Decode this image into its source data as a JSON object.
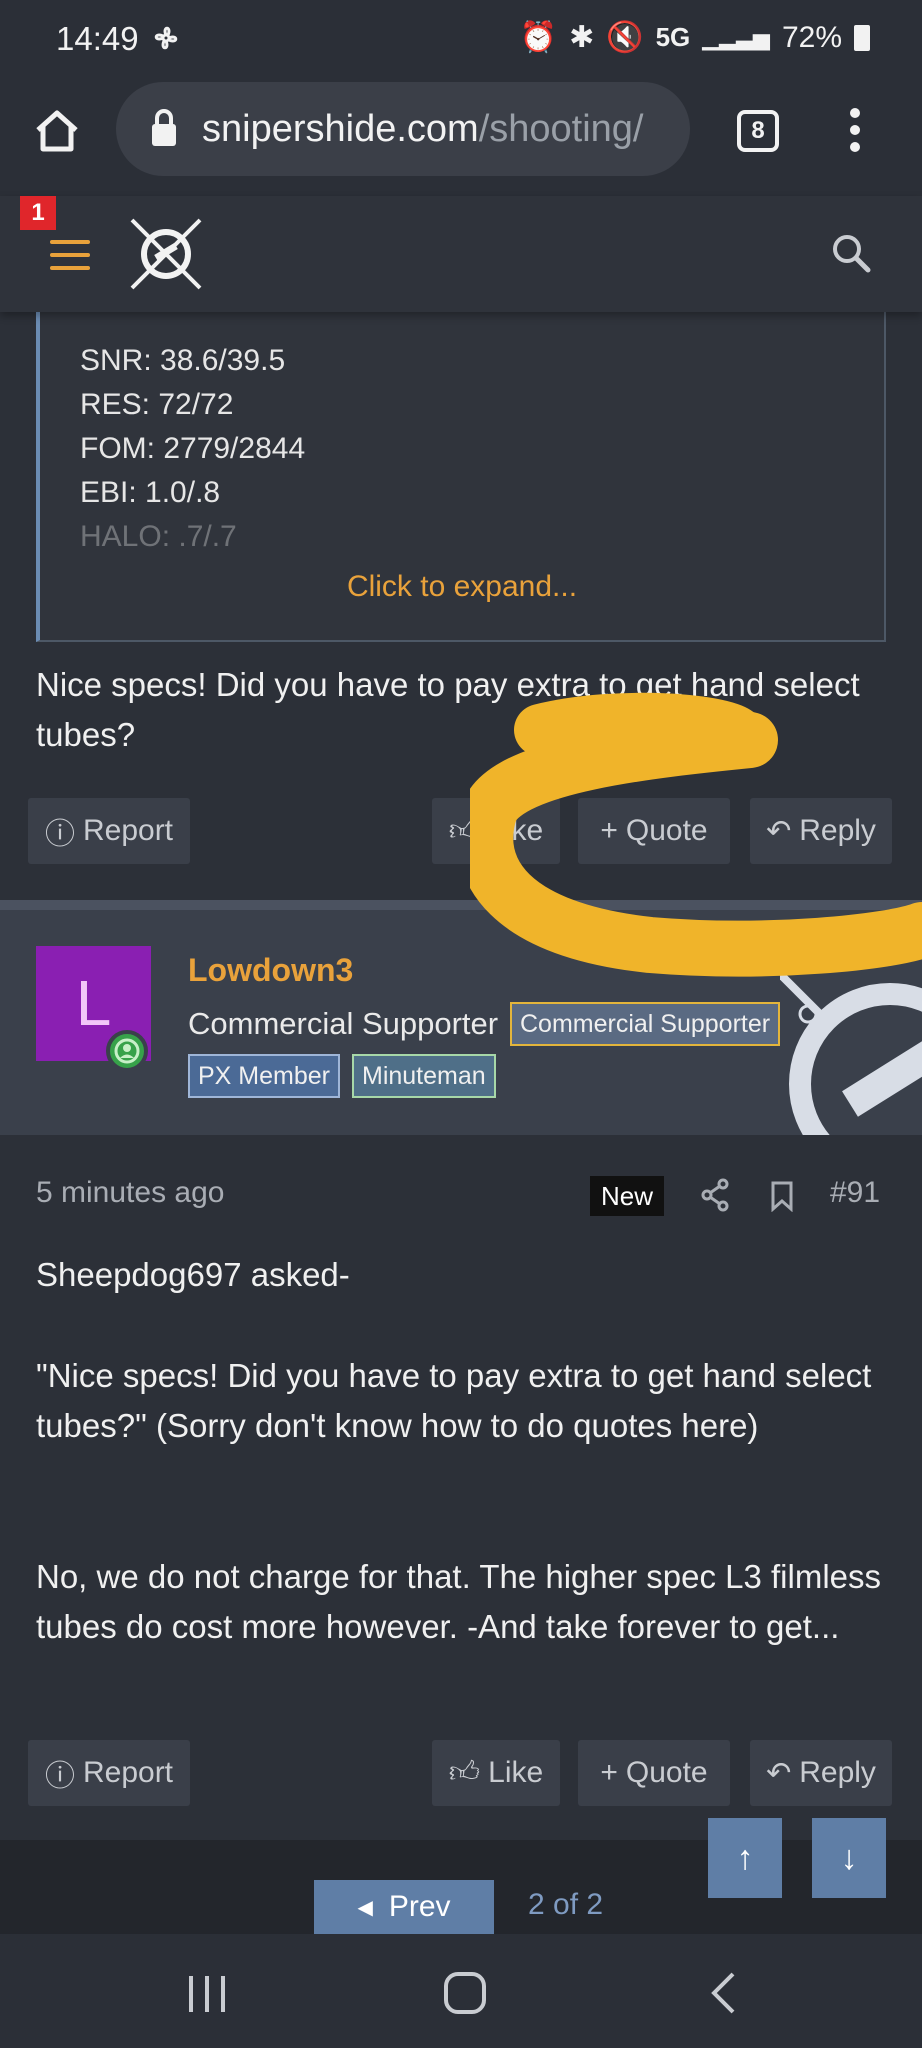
{
  "status_bar": {
    "time": "14:49",
    "network": "5G",
    "battery": "72%"
  },
  "browser": {
    "url_domain": "snipershide.com",
    "url_path": "/shooting/",
    "tab_count": "8"
  },
  "site_header": {
    "notification_count": "1"
  },
  "quote": {
    "lines": [
      "SNR: 38.6/39.5",
      "RES: 72/72",
      "FOM: 2779/2844",
      "EBI: 1.0/.8",
      "HALO: .7/.7"
    ],
    "expand_label": "Click to expand..."
  },
  "prev_post": {
    "text": "Nice specs! Did you have to pay extra to get hand select tubes?",
    "actions": {
      "report": "Report",
      "like": "Like",
      "quote": "Quote",
      "reply": "Reply"
    }
  },
  "user": {
    "avatar_letter": "L",
    "username": "Lowdown3",
    "title": "Commercial Supporter",
    "banners": [
      "Commercial Supporter",
      "PX Member",
      "Minuteman"
    ]
  },
  "post": {
    "time_ago": "5 minutes ago",
    "new_badge": "New",
    "number": "#91",
    "paragraphs": [
      "Sheepdog697 asked-",
      "\"Nice specs! Did you have to pay extra to get hand select tubes?\" (Sorry don't know how to do quotes here)",
      "No, we do not charge for that. The higher spec L3 filmless tubes do cost more however. -And take forever to get..."
    ],
    "actions": {
      "report": "Report",
      "like": "Like",
      "quote": "Quote",
      "reply": "Reply"
    }
  },
  "pagination": {
    "prev_label": "Prev",
    "page_indicator": "2 of 2"
  },
  "colors": {
    "accent": "#e9a23b",
    "annotation": "#f0b42a",
    "link_blue": "#5f7ea6",
    "avatar": "#8a1fb2"
  }
}
